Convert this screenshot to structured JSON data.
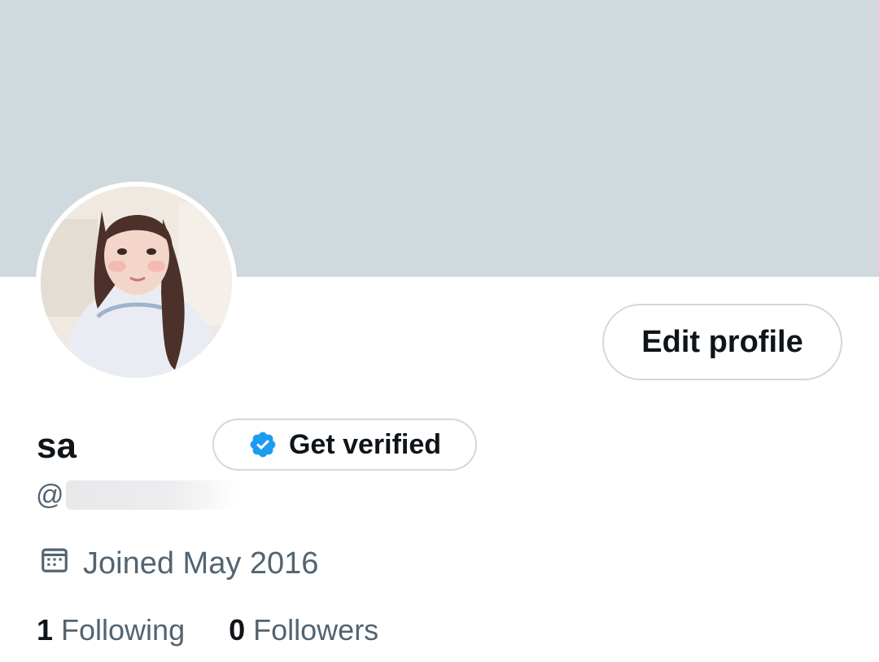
{
  "profile": {
    "display_name": "sa",
    "handle_prefix": "@",
    "joined": "Joined May 2016",
    "edit_profile_label": "Edit profile",
    "get_verified_label": "Get verified"
  },
  "stats": {
    "following_count": "1",
    "following_label": "Following",
    "followers_count": "0",
    "followers_label": "Followers"
  },
  "icons": {
    "verified": "verified-badge-icon",
    "calendar": "calendar-icon"
  },
  "colors": {
    "banner": "#cfd9de",
    "verified_blue": "#1d9bf0",
    "secondary_text": "#536471",
    "primary_text": "#0f1419",
    "button_border": "#cfd9de"
  }
}
